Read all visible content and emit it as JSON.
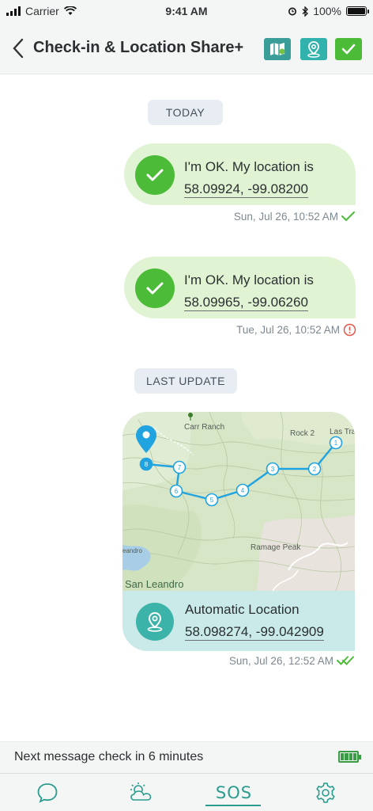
{
  "status_bar": {
    "carrier": "Carrier",
    "time": "9:41 AM",
    "battery": "100%",
    "battery_level": 1.0
  },
  "nav": {
    "title": "Check-in & Location Share+",
    "back_icon": "chevron-left-icon",
    "buttons": [
      {
        "icon": "map-icon",
        "color": "#3a9d98"
      },
      {
        "icon": "location-icon",
        "color": "#32b2ad"
      },
      {
        "icon": "check-icon",
        "color": "#4cbb38"
      }
    ]
  },
  "chat": {
    "section_today": "TODAY",
    "messages": [
      {
        "text": "I'm OK. My location is",
        "coords": "58.09924, -99.08200",
        "timestamp": "Sun, Jul 26, 10:52 AM",
        "status": "sent",
        "status_icon": "check-icon"
      },
      {
        "text": "I'm OK. My location is",
        "coords": "58.09965, -99.06260",
        "timestamp": "Tue, Jul 26, 10:52 AM",
        "status": "error",
        "status_icon": "error-info-icon"
      }
    ],
    "section_last_update": "LAST UPDATE",
    "map_message": {
      "map_labels": {
        "carr_ranch": "Carr Ranch",
        "rock": "Rock 2",
        "las_trampas": "Las Tra",
        "ramage_peak": "Ramage Peak",
        "san_leandro": "San Leandro",
        "leandro_small": "eandro"
      },
      "track_points": [
        "1",
        "2",
        "3",
        "4",
        "5",
        "6",
        "7",
        "8"
      ],
      "title": "Automatic Location",
      "coords": "58.098274, -99.042909",
      "timestamp": "Sun, Jul 26, 12:52 AM",
      "status": "delivered",
      "status_icon": "double-check-icon"
    }
  },
  "footer": {
    "next_check": "Next message check in 6 minutes",
    "battery_icon": "battery-icon",
    "tabs": [
      {
        "icon": "chat-icon"
      },
      {
        "icon": "weather-icon"
      },
      {
        "label": "SOS",
        "active": true
      },
      {
        "icon": "settings-icon"
      }
    ]
  },
  "colors": {
    "accent": "#2b9c8e",
    "ok_green": "#4cbb38",
    "bubble_bg": "#e0f4d4",
    "location_bg": "#c9eae8",
    "error": "#e2574c"
  }
}
